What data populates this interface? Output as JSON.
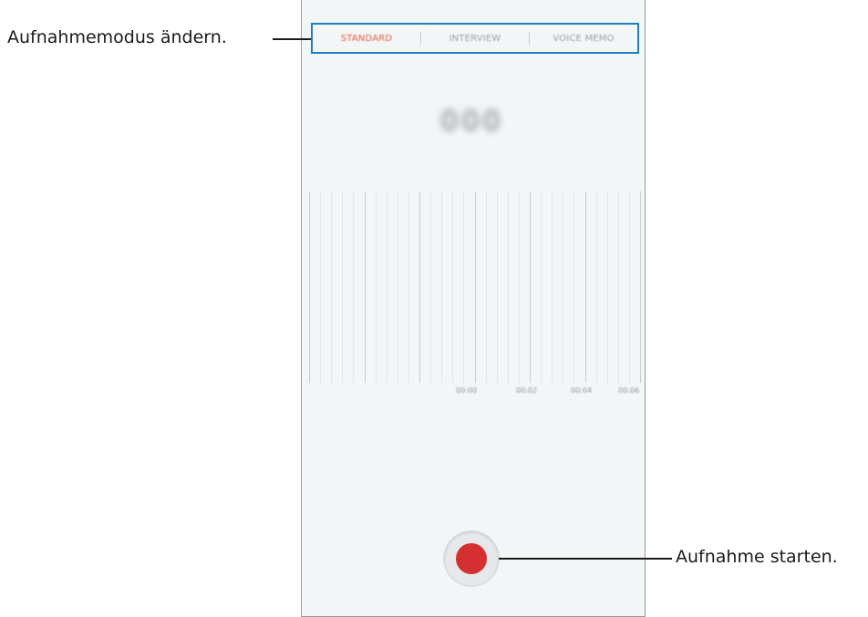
{
  "modes": {
    "tabs": [
      {
        "label": "STANDARD",
        "active": true
      },
      {
        "label": "INTERVIEW",
        "active": false
      },
      {
        "label": "VOICE MEMO",
        "active": false
      }
    ],
    "active_color": "#e45a3c"
  },
  "timer": {
    "digits": [
      "0",
      "0",
      "0"
    ]
  },
  "waveform": {
    "time_labels": [
      "00:00",
      "00:02",
      "00:04",
      "00:06"
    ]
  },
  "record": {
    "icon": "record-dot-icon",
    "color": "#d43031"
  },
  "callouts": {
    "mode_change": "Aufnahmemodus ändern.",
    "start_recording": "Aufnahme starten."
  },
  "highlight_color": "#1e7fbf"
}
